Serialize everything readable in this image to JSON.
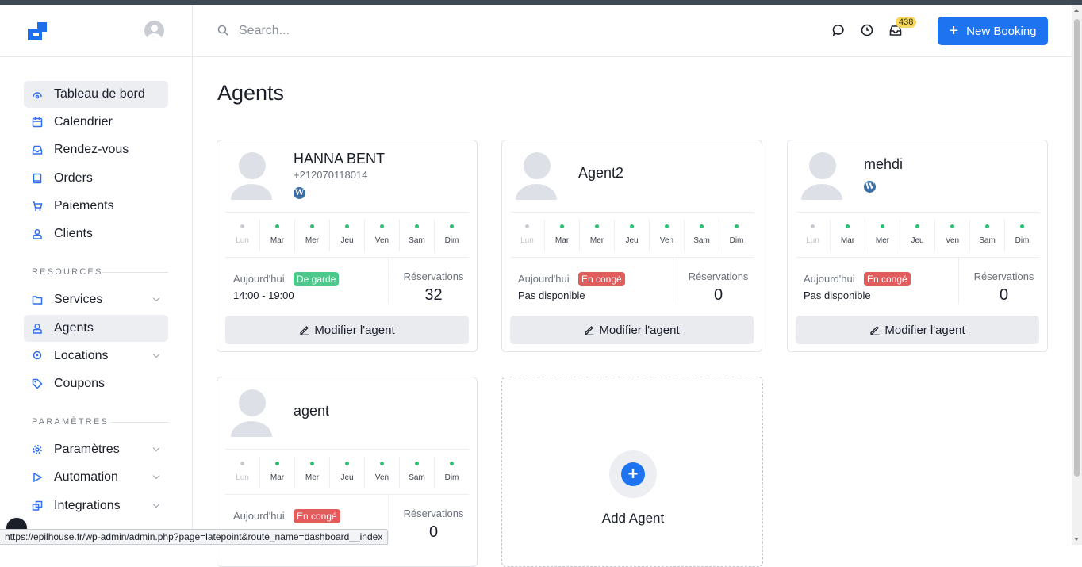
{
  "header": {
    "search_placeholder": "Search...",
    "notification_count": "438",
    "new_booking_label": "New Booking"
  },
  "sidebar": {
    "items": [
      {
        "label": "Tableau de bord",
        "icon": "dashboard-icon"
      },
      {
        "label": "Calendrier",
        "icon": "calendar-icon"
      },
      {
        "label": "Rendez-vous",
        "icon": "inbox-icon"
      },
      {
        "label": "Orders",
        "icon": "book-icon"
      },
      {
        "label": "Paiements",
        "icon": "cart-icon"
      },
      {
        "label": "Clients",
        "icon": "user-icon"
      }
    ],
    "resources_label": "RESOURCES",
    "resources": [
      {
        "label": "Services",
        "icon": "folder-icon"
      },
      {
        "label": "Agents",
        "icon": "user-icon"
      },
      {
        "label": "Locations",
        "icon": "map-pin-icon"
      },
      {
        "label": "Coupons",
        "icon": "tag-icon"
      }
    ],
    "settings_label": "PARAMÈTRES",
    "settings": [
      {
        "label": "Paramètres",
        "icon": "gear-icon"
      },
      {
        "label": "Automation",
        "icon": "play-icon"
      },
      {
        "label": "Integrations",
        "icon": "integrations-icon"
      }
    ]
  },
  "main": {
    "title": "Agents",
    "days": [
      "Lun",
      "Mar",
      "Mer",
      "Jeu",
      "Ven",
      "Sam",
      "Dim"
    ],
    "today_label": "Aujourd'hui",
    "reservations_label": "Réservations",
    "edit_label": "Modifier l'agent",
    "agents": [
      {
        "name": "HANNA BENT",
        "phone": "+212070118014",
        "status": "De garde",
        "hours": "14:00 - 19:00",
        "reservations": "32"
      },
      {
        "name": "Agent2",
        "status": "En congé",
        "hours": "Pas disponible",
        "reservations": "0"
      },
      {
        "name": "mehdi",
        "status": "En congé",
        "hours": "Pas disponible",
        "reservations": "0"
      },
      {
        "name": "agent",
        "status": "En congé",
        "reservations": "0"
      }
    ],
    "add_agent_label": "Add Agent"
  },
  "status_url": "https://epilhouse.fr/wp-admin/admin.php?page=latepoint&route_name=dashboard__index",
  "colors": {
    "accent": "#1e73f0",
    "on_duty": "#4cc98a",
    "off_duty": "#e25c5c",
    "badge": "#f6d860"
  }
}
